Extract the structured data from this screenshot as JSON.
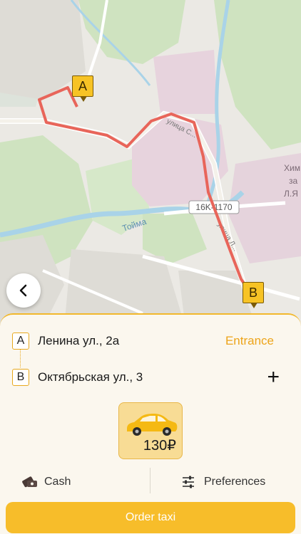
{
  "map": {
    "road_label_1": "16K-1170",
    "river_label": "Тойма",
    "street_label_1": "улица С...",
    "street_label_2": "улица Л...",
    "district_label_1": "Хим",
    "district_label_2": "за",
    "district_label_3": "Л.Я",
    "pin_a": "A",
    "pin_b": "B",
    "route_color": "#e8655a"
  },
  "route": {
    "from_badge": "A",
    "from_address": "Ленина ул., 2а",
    "entrance_label": "Entrance",
    "to_badge": "B",
    "to_address": "Октябрьская ул., 3",
    "add_stop_label": "+"
  },
  "tariff": {
    "price": "130₽",
    "icon": "taxi-car-icon",
    "accent": "#f7c325"
  },
  "footer": {
    "payment_label": "Cash",
    "payment_icon": "cash-icon",
    "preferences_label": "Preferences",
    "preferences_icon": "sliders-icon",
    "order_label": "Order taxi",
    "order_color": "#f7bd2a"
  }
}
